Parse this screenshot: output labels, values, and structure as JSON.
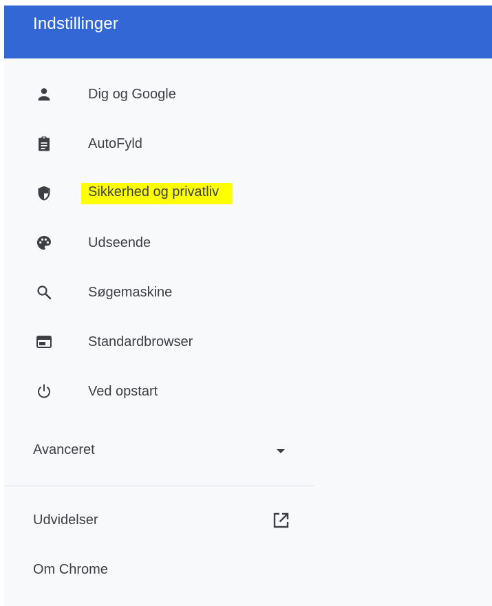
{
  "header": {
    "title": "Indstillinger",
    "color": "#3367d6"
  },
  "nav": {
    "items": [
      {
        "label": "Dig og Google",
        "icon": "person-icon"
      },
      {
        "label": "AutoFyld",
        "icon": "clipboard-icon"
      },
      {
        "label": "Sikkerhed og privatliv",
        "icon": "shield-icon",
        "highlighted": true,
        "highlight_color": "#ffff00"
      },
      {
        "label": "Udseende",
        "icon": "palette-icon"
      },
      {
        "label": "Søgemaskine",
        "icon": "search-icon"
      },
      {
        "label": "Standardbrowser",
        "icon": "browser-window-icon"
      },
      {
        "label": "Ved opstart",
        "icon": "power-icon"
      }
    ]
  },
  "advanced": {
    "label": "Avanceret",
    "icon": "arrow-drop-down-icon"
  },
  "extensions": {
    "label": "Udvidelser",
    "icon": "open-in-new-icon"
  },
  "about": {
    "label": "Om Chrome"
  }
}
